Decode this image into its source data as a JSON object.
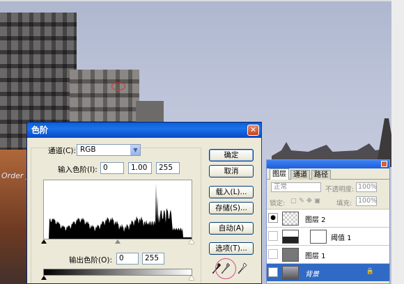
{
  "levels_dialog": {
    "title": "色阶",
    "close_glyph": "✕",
    "channel_label": "通道(C):",
    "channel_value": "RGB",
    "input_levels_label": "输入色阶(I):",
    "input_black": "0",
    "input_gamma": "1.00",
    "input_white": "255",
    "output_levels_label": "输出色阶(O):",
    "output_black": "0",
    "output_white": "255",
    "buttons": {
      "ok": "确定",
      "cancel": "取消",
      "load": "载入(L)...",
      "save": "存储(S)...",
      "auto": "自动(A)",
      "options": "选项(T)..."
    }
  },
  "layers_panel": {
    "tabs": [
      "图层",
      "通道",
      "路径"
    ],
    "blend_mode": "正常",
    "opacity_label": "不透明度:",
    "opacity_value": "100%",
    "lock_label": "锁定:",
    "fill_label": "填充:",
    "fill_value": "100%",
    "layers": [
      {
        "name": "图层 2",
        "visible": true,
        "selected": false
      },
      {
        "name": "阈值 1",
        "visible": false,
        "selected": false
      },
      {
        "name": "图层 1",
        "visible": false,
        "selected": false
      },
      {
        "name": "背景",
        "visible": true,
        "selected": true
      }
    ]
  },
  "photo": {
    "shop_sign_text": "Order yo"
  },
  "colors": {
    "title_bar": "#0a5fd8",
    "selection": "#316ac5",
    "dialog_bg": "#ece9d8"
  }
}
